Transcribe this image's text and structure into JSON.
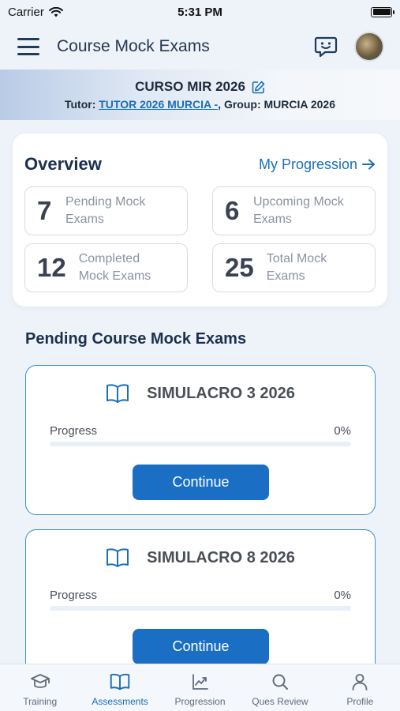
{
  "status_bar": {
    "carrier": "Carrier",
    "time": "5:31 PM"
  },
  "header": {
    "title": "Course Mock Exams",
    "icons": [
      "menu-icon",
      "chat-icon",
      "avatar"
    ]
  },
  "course": {
    "title": "CURSO MIR 2026",
    "tutor_label": "Tutor: ",
    "tutor_name": "TUTOR 2026 MURCIA -",
    "group_label": ", Group: ",
    "group_name": "MURCIA 2026"
  },
  "overview": {
    "title": "Overview",
    "progression_link": "My Progression",
    "stats": [
      {
        "value": "7",
        "label_line1": "Pending Mock",
        "label_line2": "Exams"
      },
      {
        "value": "6",
        "label_line1": "Upcoming Mock",
        "label_line2": "Exams"
      },
      {
        "value": "12",
        "label_line1": "Completed",
        "label_line2": "Mock Exams"
      },
      {
        "value": "25",
        "label_line1": "Total Mock",
        "label_line2": "Exams"
      }
    ]
  },
  "pending": {
    "section_title": "Pending Course Mock Exams",
    "exams": [
      {
        "title": "SIMULACRO 3 2026",
        "progress_label": "Progress",
        "progress_text": "0%",
        "progress": 0,
        "button": "Continue"
      },
      {
        "title": "SIMULACRO 8 2026",
        "progress_label": "Progress",
        "progress_text": "0%",
        "progress": 0,
        "button": "Continue"
      }
    ]
  },
  "tab_bar": {
    "tabs": [
      {
        "label": "Training",
        "icon": "graduation-cap-icon"
      },
      {
        "label": "Assessments",
        "icon": "open-book-icon",
        "active": true
      },
      {
        "label": "Progression",
        "icon": "chart-icon"
      },
      {
        "label": "Ques Review",
        "icon": "search-icon"
      },
      {
        "label": "Profile",
        "icon": "user-icon"
      }
    ]
  },
  "colors": {
    "accent": "#1a6fc4",
    "card_border": "#3d8dd0",
    "title": "#1b2f4e"
  }
}
